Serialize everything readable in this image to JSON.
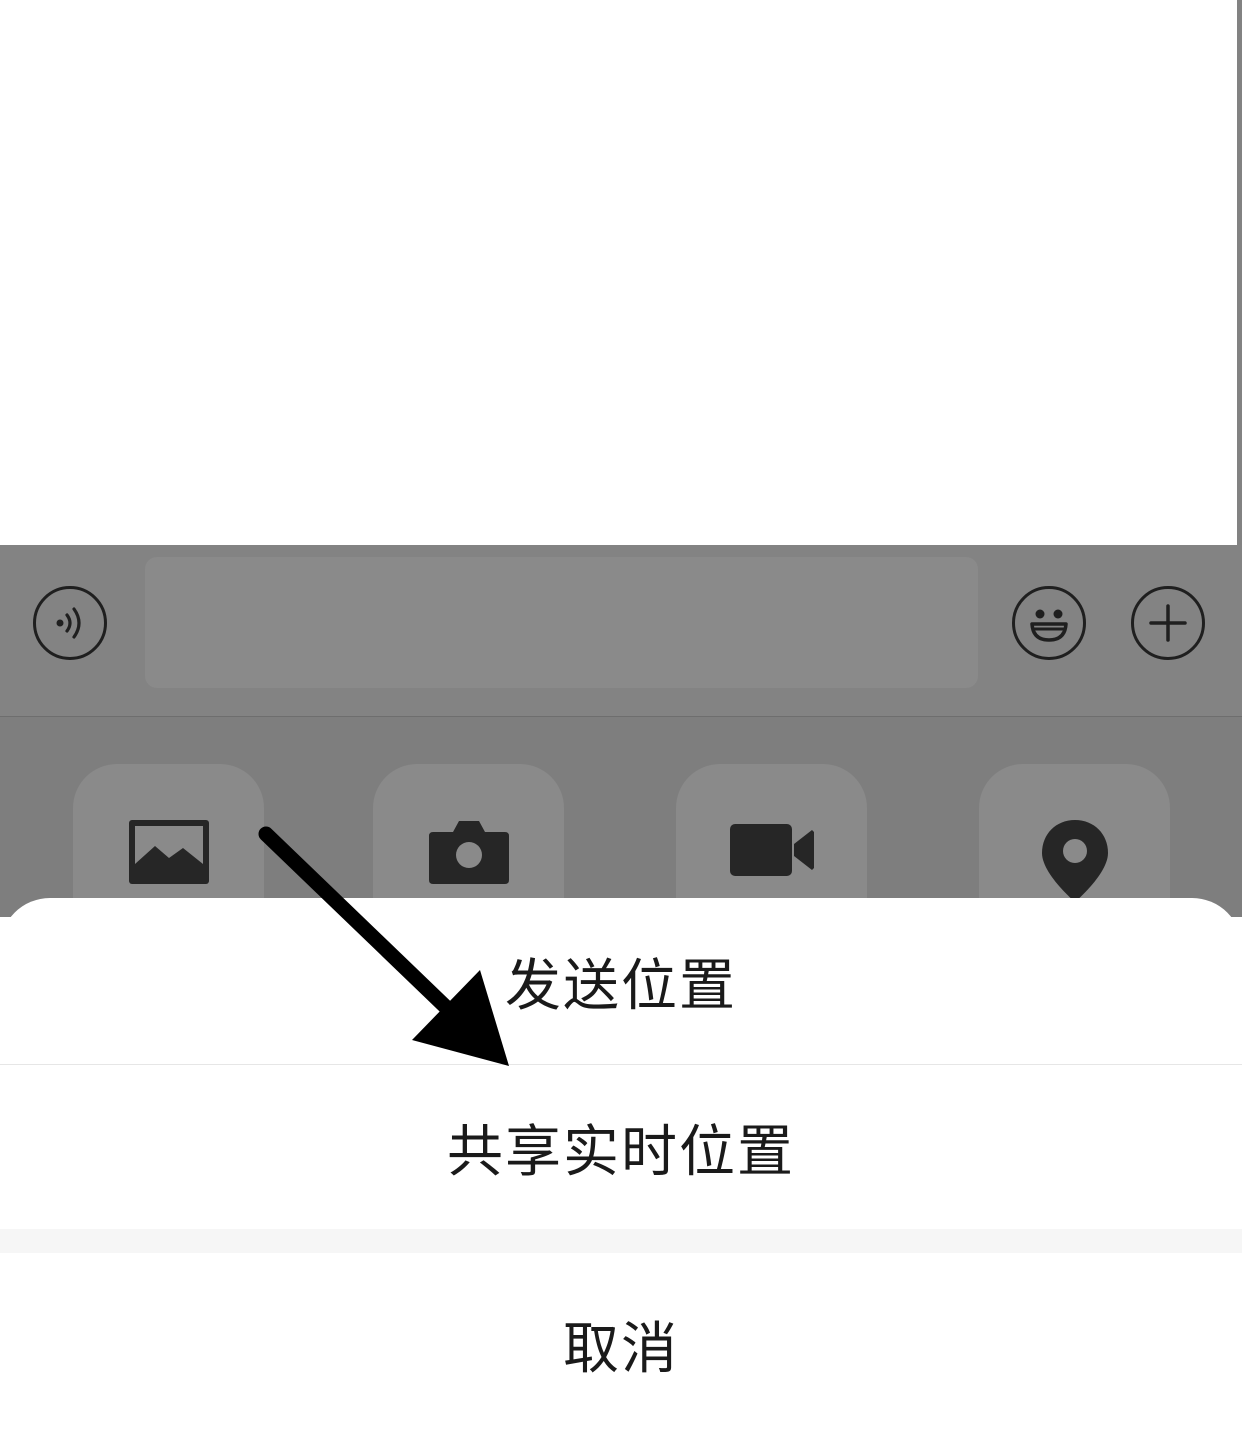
{
  "input_bar": {
    "voice_icon": "voice-wave-icon",
    "message_placeholder": "",
    "emoji_icon": "smiley-icon",
    "more_icon": "plus-icon"
  },
  "tools": [
    {
      "icon": "image-icon"
    },
    {
      "icon": "camera-icon"
    },
    {
      "icon": "video-camera-icon"
    },
    {
      "icon": "location-pin-icon"
    }
  ],
  "action_sheet": {
    "send_location": "发送位置",
    "share_live_location": "共享实时位置",
    "cancel": "取消"
  },
  "annotation": {
    "arrow_color": "#000000"
  },
  "colors": {
    "dim_overlay": "#838383",
    "icon_dark": "#1f1f1f",
    "sheet_bg": "#ffffff",
    "sheet_gap": "#f6f6f6"
  }
}
